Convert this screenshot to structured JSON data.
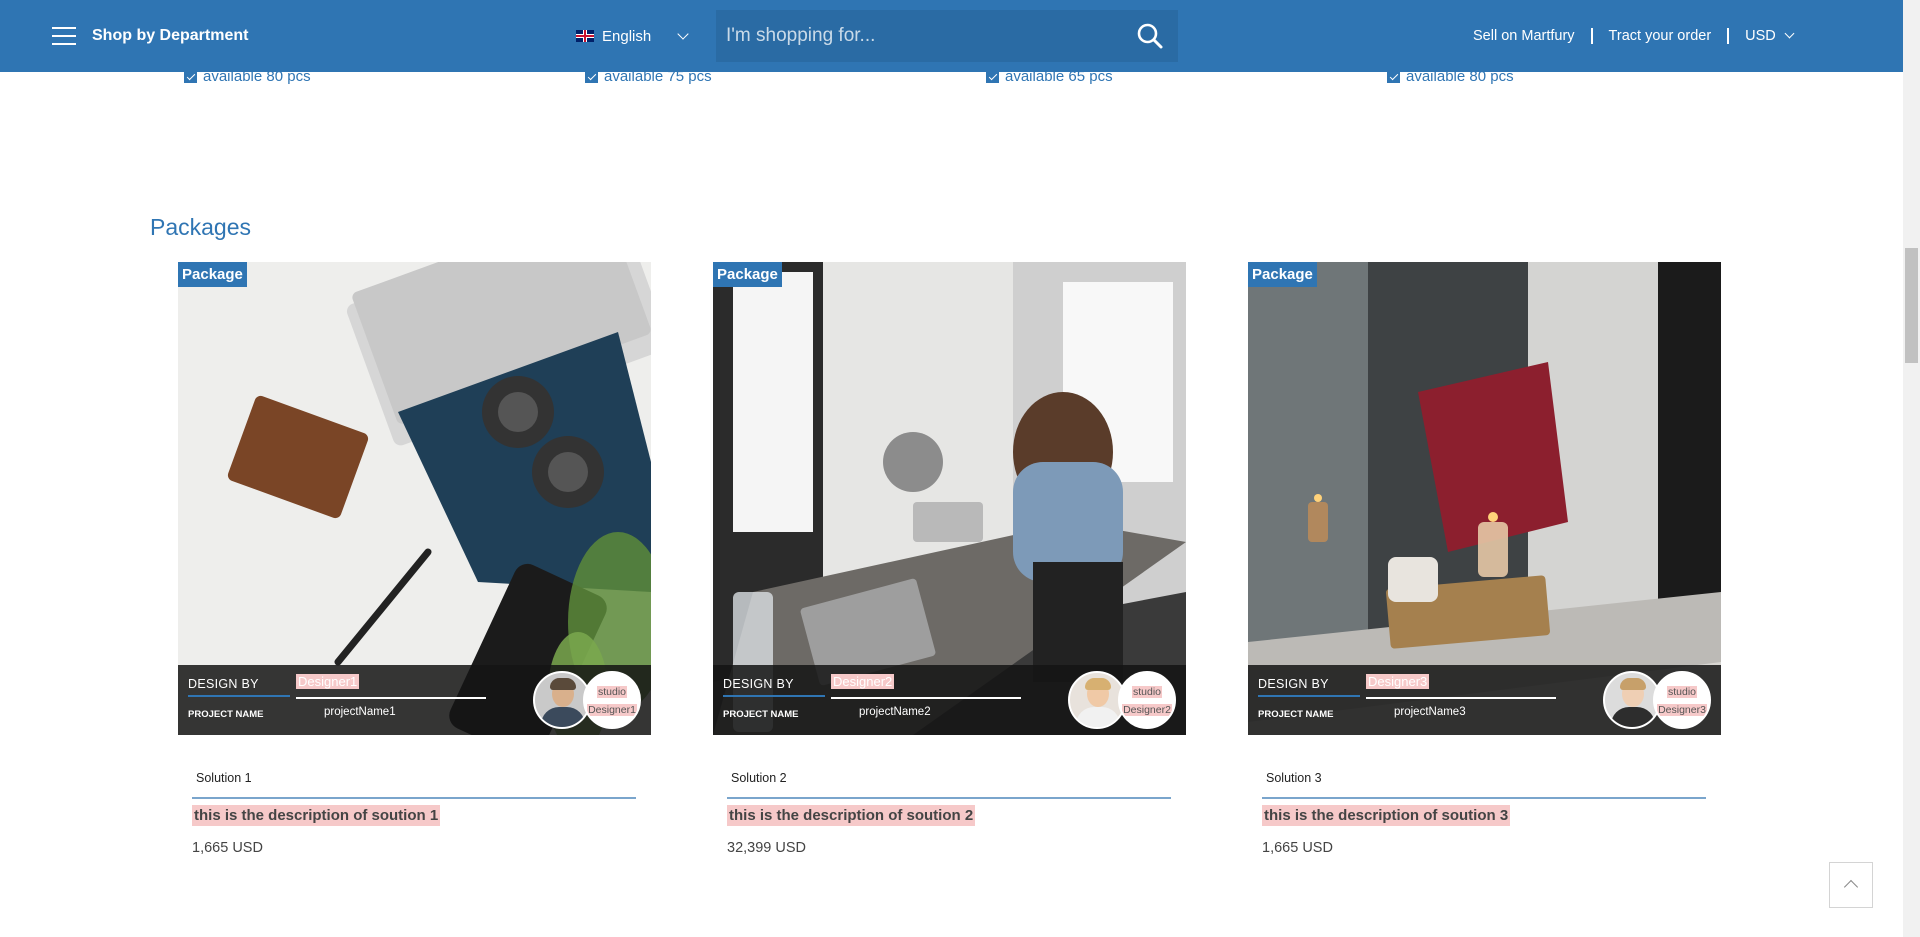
{
  "header": {
    "department_label": "Shop by Department",
    "language": "English",
    "search_placeholder": "I'm shopping for...",
    "sell_link": "Sell on Martfury",
    "track_link": "Tract your order",
    "currency": "USD"
  },
  "availability": [
    "available 80 pcs",
    "available 75 pcs",
    "available 65 pcs",
    "available 80 pcs"
  ],
  "section_title": "Packages",
  "cards": [
    {
      "badge": "Package",
      "design_by_label": "DESIGN BY",
      "designer": "Designer1",
      "project_label": "PROJECT NAME",
      "project": "projectName1",
      "studio_line1": "studio",
      "studio_line2": "Designer1",
      "solution": "Solution 1",
      "description": "this is the description of soution 1",
      "price": "1,665 USD"
    },
    {
      "badge": "Package",
      "design_by_label": "DESIGN BY",
      "designer": "Designer2",
      "project_label": "PROJECT NAME",
      "project": "projectName2",
      "studio_line1": "studio",
      "studio_line2": "Designer2",
      "solution": "Solution 2",
      "description": "this is the description of soution 2",
      "price": "32,399 USD"
    },
    {
      "badge": "Package",
      "design_by_label": "DESIGN BY",
      "designer": "Designer3",
      "project_label": "PROJECT NAME",
      "project": "projectName3",
      "studio_line1": "studio",
      "studio_line2": "Designer3",
      "solution": "Solution 3",
      "description": "this is the description of soution 3",
      "price": "1,665 USD"
    }
  ],
  "colors": {
    "brand": "#2f75b3",
    "highlight": "#f6c9c9"
  },
  "icons": [
    "menu-icon",
    "uk-flag-icon",
    "chevron-down-icon",
    "search-icon",
    "check-icon",
    "chevron-up-icon"
  ]
}
